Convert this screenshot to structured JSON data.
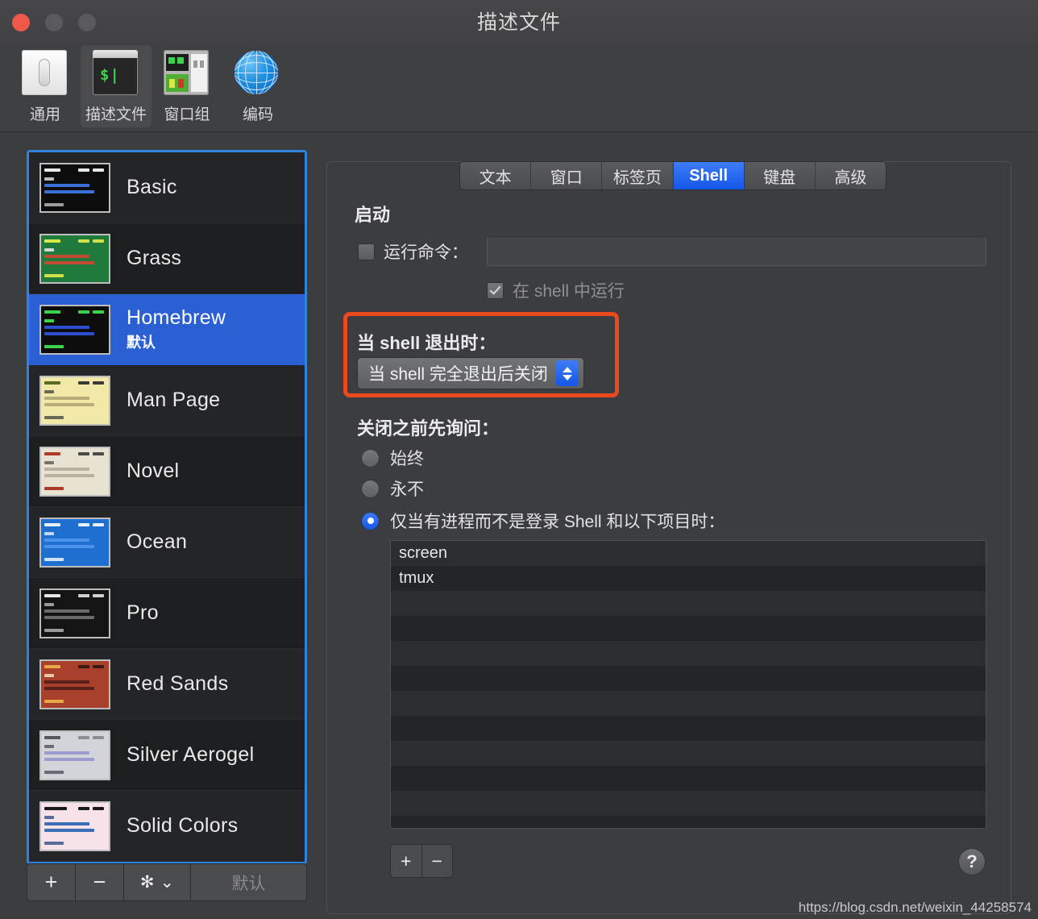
{
  "window": {
    "title": "描述文件",
    "traffic_lights": [
      "close",
      "minimize",
      "maximize"
    ]
  },
  "toolbar": {
    "items": [
      {
        "label": "通用",
        "icon": "toggle-switch-icon",
        "selected": false
      },
      {
        "label": "描述文件",
        "icon": "terminal-icon",
        "selected": true
      },
      {
        "label": "窗口组",
        "icon": "window-group-icon",
        "selected": false
      },
      {
        "label": "编码",
        "icon": "globe-icon",
        "selected": false
      }
    ]
  },
  "sidebar": {
    "profiles": [
      {
        "name": "Basic",
        "subtitle": "",
        "selected": false
      },
      {
        "name": "Grass",
        "subtitle": "",
        "selected": false
      },
      {
        "name": "Homebrew",
        "subtitle": "默认",
        "selected": true
      },
      {
        "name": "Man Page",
        "subtitle": "",
        "selected": false
      },
      {
        "name": "Novel",
        "subtitle": "",
        "selected": false
      },
      {
        "name": "Ocean",
        "subtitle": "",
        "selected": false
      },
      {
        "name": "Pro",
        "subtitle": "",
        "selected": false
      },
      {
        "name": "Red Sands",
        "subtitle": "",
        "selected": false
      },
      {
        "name": "Silver Aerogel",
        "subtitle": "",
        "selected": false
      },
      {
        "name": "Solid Colors",
        "subtitle": "",
        "selected": false
      }
    ],
    "bottom_bar": {
      "add_label": "+",
      "remove_label": "−",
      "gear_label": "✻",
      "gear_chevron": "⌄",
      "default_label": "默认"
    }
  },
  "tabs": [
    {
      "label": "文本",
      "active": false
    },
    {
      "label": "窗口",
      "active": false
    },
    {
      "label": "标签页",
      "active": false
    },
    {
      "label": "Shell",
      "active": true
    },
    {
      "label": "键盘",
      "active": false
    },
    {
      "label": "高级",
      "active": false
    }
  ],
  "shell": {
    "startup_heading": "启动",
    "run_command_label": "运行命令：",
    "run_command_value": "",
    "run_command_placeholder": "",
    "run_in_shell_label": "在 shell 中运行",
    "run_in_shell_checked": true,
    "exit_heading": "当 shell 退出时：",
    "exit_popup_value": "当 shell 完全退出后关闭",
    "ask_heading": "关闭之前先询问：",
    "ask_options": [
      {
        "label": "始终",
        "selected": false
      },
      {
        "label": "永不",
        "selected": false
      },
      {
        "label": "仅当有进程而不是登录 Shell 和以下项目时：",
        "selected": true
      }
    ],
    "process_items": [
      "screen",
      "tmux"
    ],
    "list_add_label": "+",
    "list_remove_label": "−",
    "help_label": "?"
  },
  "colors": {
    "window_bg": "#3c3d41",
    "accent_blue": "#2b5fd4",
    "tab_active_blue": "#1456e8",
    "highlight_orange": "#ec4a1e",
    "sidebar_border": "#2f83dd"
  },
  "watermark": "https://blog.csdn.net/weixin_44258574"
}
